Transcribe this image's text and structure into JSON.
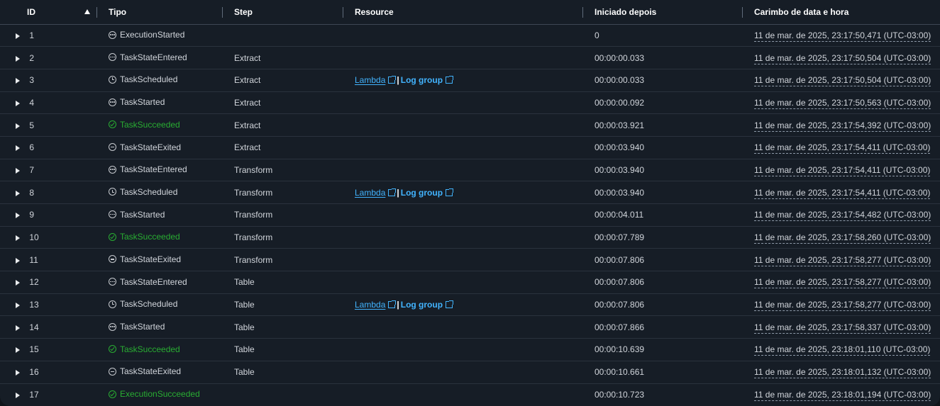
{
  "columns": {
    "id": "ID",
    "type": "Tipo",
    "step": "Step",
    "resource": "Resource",
    "started_after": "Iniciado depois",
    "timestamp": "Carimbo de data e hora"
  },
  "resource_labels": {
    "lambda": "Lambda",
    "separator": "|",
    "log_group": "Log group"
  },
  "colors": {
    "success": "#29ad32",
    "link": "#42b4ff",
    "background": "#161d26"
  },
  "rows": [
    {
      "id": "1",
      "icon": "dots",
      "type": "ExecutionStarted",
      "step": "",
      "has_resource": false,
      "started_after": "0",
      "timestamp": "11 de mar. de 2025, 23:17:50,471 (UTC-03:00)"
    },
    {
      "id": "2",
      "icon": "dots",
      "type": "TaskStateEntered",
      "step": "Extract",
      "has_resource": false,
      "started_after": "00:00:00.033",
      "timestamp": "11 de mar. de 2025, 23:17:50,504 (UTC-03:00)"
    },
    {
      "id": "3",
      "icon": "clock",
      "type": "TaskScheduled",
      "step": "Extract",
      "has_resource": true,
      "started_after": "00:00:00.033",
      "timestamp": "11 de mar. de 2025, 23:17:50,504 (UTC-03:00)"
    },
    {
      "id": "4",
      "icon": "dots",
      "type": "TaskStarted",
      "step": "Extract",
      "has_resource": false,
      "started_after": "00:00:00.092",
      "timestamp": "11 de mar. de 2025, 23:17:50,563 (UTC-03:00)"
    },
    {
      "id": "5",
      "icon": "check",
      "type": "TaskSucceeded",
      "step": "Extract",
      "has_resource": false,
      "started_after": "00:00:03.921",
      "timestamp": "11 de mar. de 2025, 23:17:54,392 (UTC-03:00)"
    },
    {
      "id": "6",
      "icon": "minus",
      "type": "TaskStateExited",
      "step": "Extract",
      "has_resource": false,
      "started_after": "00:00:03.940",
      "timestamp": "11 de mar. de 2025, 23:17:54,411 (UTC-03:00)"
    },
    {
      "id": "7",
      "icon": "dots",
      "type": "TaskStateEntered",
      "step": "Transform",
      "has_resource": false,
      "started_after": "00:00:03.940",
      "timestamp": "11 de mar. de 2025, 23:17:54,411 (UTC-03:00)"
    },
    {
      "id": "8",
      "icon": "clock",
      "type": "TaskScheduled",
      "step": "Transform",
      "has_resource": true,
      "started_after": "00:00:03.940",
      "timestamp": "11 de mar. de 2025, 23:17:54,411 (UTC-03:00)"
    },
    {
      "id": "9",
      "icon": "dots",
      "type": "TaskStarted",
      "step": "Transform",
      "has_resource": false,
      "started_after": "00:00:04.011",
      "timestamp": "11 de mar. de 2025, 23:17:54,482 (UTC-03:00)"
    },
    {
      "id": "10",
      "icon": "check",
      "type": "TaskSucceeded",
      "step": "Transform",
      "has_resource": false,
      "started_after": "00:00:07.789",
      "timestamp": "11 de mar. de 2025, 23:17:58,260 (UTC-03:00)"
    },
    {
      "id": "11",
      "icon": "minus",
      "type": "TaskStateExited",
      "step": "Transform",
      "has_resource": false,
      "started_after": "00:00:07.806",
      "timestamp": "11 de mar. de 2025, 23:17:58,277 (UTC-03:00)"
    },
    {
      "id": "12",
      "icon": "dots",
      "type": "TaskStateEntered",
      "step": "Table",
      "has_resource": false,
      "started_after": "00:00:07.806",
      "timestamp": "11 de mar. de 2025, 23:17:58,277 (UTC-03:00)"
    },
    {
      "id": "13",
      "icon": "clock",
      "type": "TaskScheduled",
      "step": "Table",
      "has_resource": true,
      "started_after": "00:00:07.806",
      "timestamp": "11 de mar. de 2025, 23:17:58,277 (UTC-03:00)"
    },
    {
      "id": "14",
      "icon": "dots",
      "type": "TaskStarted",
      "step": "Table",
      "has_resource": false,
      "started_after": "00:00:07.866",
      "timestamp": "11 de mar. de 2025, 23:17:58,337 (UTC-03:00)"
    },
    {
      "id": "15",
      "icon": "check",
      "type": "TaskSucceeded",
      "step": "Table",
      "has_resource": false,
      "started_after": "00:00:10.639",
      "timestamp": "11 de mar. de 2025, 23:18:01,110 (UTC-03:00)"
    },
    {
      "id": "16",
      "icon": "minus",
      "type": "TaskStateExited",
      "step": "Table",
      "has_resource": false,
      "started_after": "00:00:10.661",
      "timestamp": "11 de mar. de 2025, 23:18:01,132 (UTC-03:00)"
    },
    {
      "id": "17",
      "icon": "check",
      "type": "ExecutionSucceeded",
      "step": "",
      "has_resource": false,
      "started_after": "00:00:10.723",
      "timestamp": "11 de mar. de 2025, 23:18:01,194 (UTC-03:00)"
    }
  ]
}
